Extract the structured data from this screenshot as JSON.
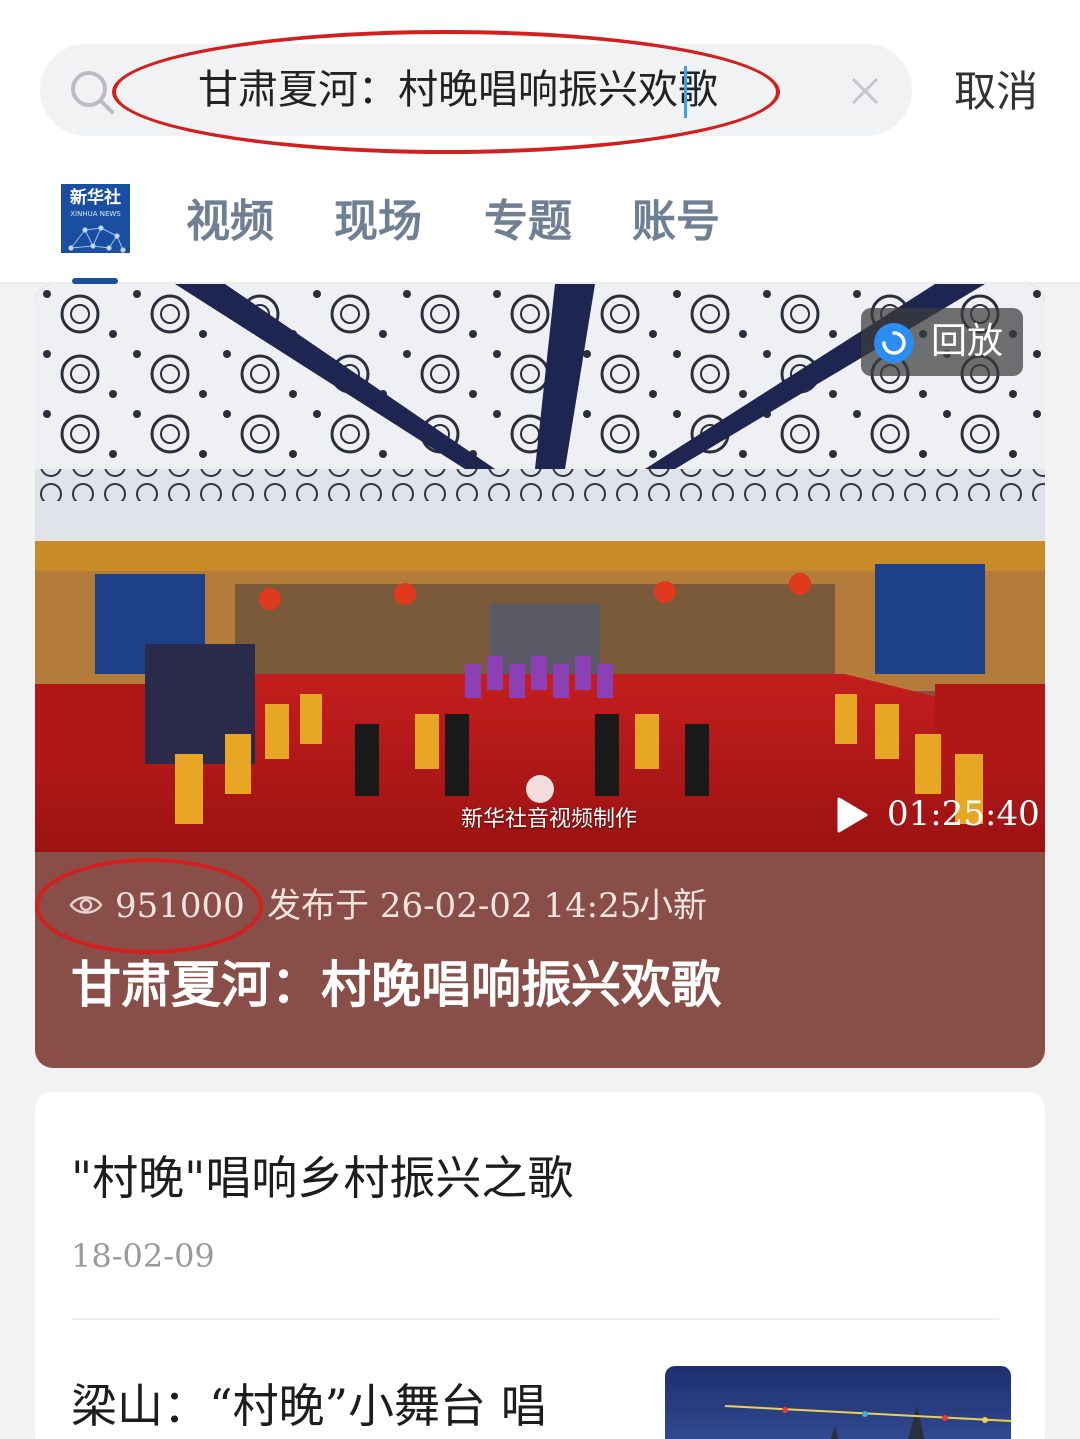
{
  "search": {
    "query": "甘肃夏河：村晚唱响振兴欢歌",
    "cancel_label": "取消"
  },
  "tabs": [
    {
      "label": "视频"
    },
    {
      "label": "现场"
    },
    {
      "label": "专题"
    },
    {
      "label": "账号"
    }
  ],
  "logo": {
    "text": "新华社",
    "sub": "XINHUA NEWS"
  },
  "featured": {
    "badge_label": "回放",
    "duration": "01:25:40",
    "watermark": "新华社音视频制作",
    "views": "951000",
    "published": "发布于 26-02-02 14:25",
    "author": "小新",
    "title": "甘肃夏河：村晚唱响振兴欢歌"
  },
  "results": [
    {
      "title": "\"村晚\"唱响乡村振兴之歌",
      "date": "18-02-09"
    },
    {
      "title": "梁山：“村晚”小舞台 唱"
    }
  ],
  "colors": {
    "card_background": "#8a4e48",
    "annotation_red": "#d41f1f",
    "brand_blue": "#1a4ea0"
  }
}
